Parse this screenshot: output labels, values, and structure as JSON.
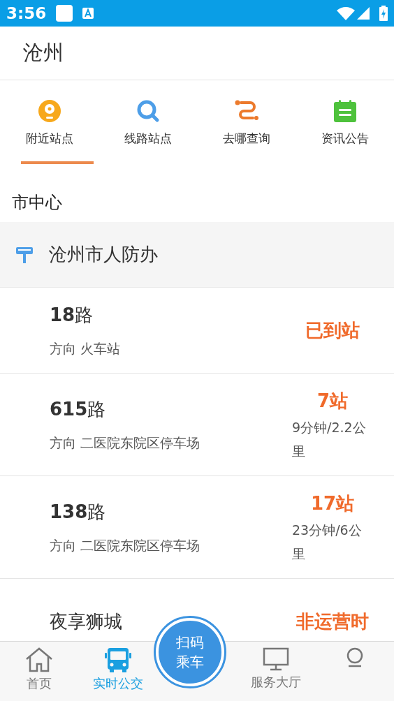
{
  "status_bar": {
    "time": "3:56"
  },
  "header": {
    "title": "沧州"
  },
  "tabs": [
    {
      "label": "附近站点",
      "selected": true,
      "kind": "nearby"
    },
    {
      "label": "线路站点",
      "selected": false,
      "kind": "search"
    },
    {
      "label": "去哪查询",
      "selected": false,
      "kind": "route"
    },
    {
      "label": "资讯公告",
      "selected": false,
      "kind": "notice"
    }
  ],
  "section": {
    "title": "市中心"
  },
  "station": {
    "name": "沧州市人防办"
  },
  "routes": [
    {
      "name": "**18**路",
      "direction": "方向 火车站",
      "status": "已到站"
    },
    {
      "name": "**615**路",
      "direction": "方向 二医院东院区停车场",
      "status": "7站",
      "detail": "9分钟/2.2公里"
    },
    {
      "name": "**138**路",
      "direction": "方向 二医院东院区停车场",
      "status": "17站",
      "detail": "23分钟/6公里"
    },
    {
      "name": "夜享狮城",
      "status": "非运营时"
    }
  ],
  "nav": [
    {
      "label": "首页",
      "selected": false,
      "kind": "home"
    },
    {
      "label": "实时公交",
      "selected": true,
      "kind": "bus"
    },
    {
      "label": "扫码乘车",
      "kind": "scan"
    },
    {
      "label": "服务大厅",
      "selected": false,
      "kind": "service"
    },
    {
      "selected": false,
      "kind": "me"
    }
  ]
}
